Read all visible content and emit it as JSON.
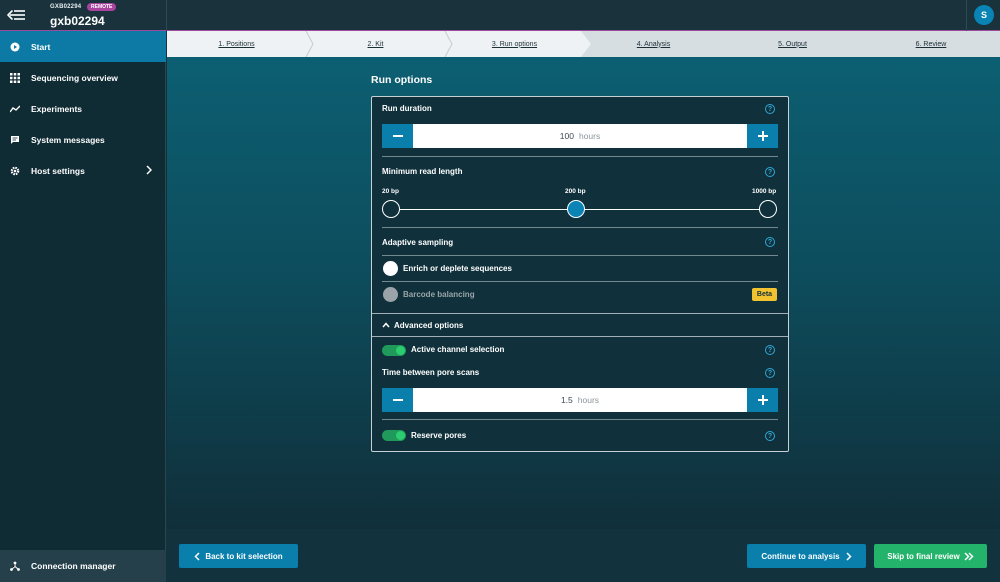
{
  "header": {
    "host_small": "GXB02294",
    "remote_badge": "REMOTE",
    "host_name": "gxb02294",
    "avatar_initial": "S"
  },
  "sidebar": {
    "items": [
      {
        "label": "Start",
        "icon": "play-circle-icon",
        "active": true
      },
      {
        "label": "Sequencing overview",
        "icon": "grid-icon"
      },
      {
        "label": "Experiments",
        "icon": "chart-line-icon"
      },
      {
        "label": "System messages",
        "icon": "message-icon"
      },
      {
        "label": "Host settings",
        "icon": "gear-icon"
      }
    ],
    "connection_manager": "Connection manager"
  },
  "stepper": {
    "steps": [
      "1. Positions",
      "2. Kit",
      "3. Run options",
      "4. Analysis",
      "5. Output",
      "6. Review"
    ],
    "current": "3. Run options"
  },
  "page_title": "Run options",
  "run_duration": {
    "label": "Run duration",
    "value": "100",
    "unit": "hours"
  },
  "min_read_length": {
    "label": "Minimum read length",
    "options": [
      "20 bp",
      "200 bp",
      "1000 bp"
    ],
    "selected": "200 bp"
  },
  "adaptive_sampling": {
    "label": "Adaptive sampling",
    "enrich_label": "Enrich or deplete sequences",
    "barcode_label": "Barcode balancing",
    "beta_badge": "Beta"
  },
  "advanced": {
    "toggle_label": "Advanced options",
    "active_channel_selection": "Active channel selection",
    "pore_scan_label": "Time between pore scans",
    "pore_scan_value": "1.5",
    "pore_scan_unit": "hours",
    "reserve_pores": "Reserve pores"
  },
  "footer": {
    "back_label": "Back to kit selection",
    "continue_label": "Continue to analysis",
    "skip_label": "Skip to final review"
  },
  "help_glyph": "?",
  "colors": {
    "accent": "#0a7fac",
    "success": "#23b36a",
    "beta": "#f2c230",
    "remote": "#a8449f"
  }
}
